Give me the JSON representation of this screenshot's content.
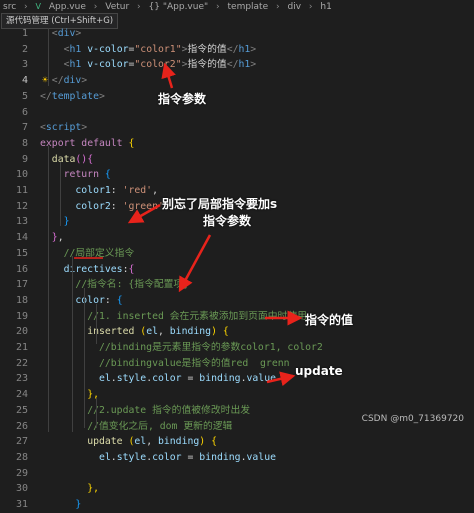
{
  "breadcrumb": {
    "items": [
      "src",
      "App.vue",
      "Vetur",
      "{} \"App.vue\"",
      "template",
      "div",
      "h1"
    ],
    "vue_badge": "V",
    "separator": "›"
  },
  "tooltip": {
    "text": "源代码管理 (Ctrl+Shift+G)"
  },
  "editor": {
    "active_line": 4,
    "lines": [
      {
        "n": "1",
        "tokens": [
          [
            "  ",
            "t-txt"
          ],
          [
            "<",
            "t-tag"
          ],
          [
            "div",
            "t-tagname"
          ],
          [
            ">",
            "t-tag"
          ]
        ]
      },
      {
        "n": "2",
        "tokens": [
          [
            "    ",
            "t-txt"
          ],
          [
            "<",
            "t-tag"
          ],
          [
            "h1",
            "t-tagname"
          ],
          [
            " ",
            "t-txt"
          ],
          [
            "v-color",
            "t-attr"
          ],
          [
            "=",
            "t-txt"
          ],
          [
            "\"color1\"",
            "t-str"
          ],
          [
            ">",
            "t-tag"
          ],
          [
            "指令的值",
            "t-txt"
          ],
          [
            "</",
            "t-tag"
          ],
          [
            "h1",
            "t-tagname"
          ],
          [
            ">",
            "t-tag"
          ]
        ]
      },
      {
        "n": "3",
        "tokens": [
          [
            "    ",
            "t-txt"
          ],
          [
            "<",
            "t-tag"
          ],
          [
            "h1",
            "t-tagname"
          ],
          [
            " ",
            "t-txt"
          ],
          [
            "v-color",
            "t-attr"
          ],
          [
            "=",
            "t-txt"
          ],
          [
            "\"color2\"",
            "t-str"
          ],
          [
            ">",
            "t-tag"
          ],
          [
            "指令的值",
            "t-txt"
          ],
          [
            "</",
            "t-tag"
          ],
          [
            "h1",
            "t-tagname"
          ],
          [
            ">",
            "t-tag"
          ]
        ]
      },
      {
        "n": "4",
        "tokens": [
          [
            "  ",
            "t-txt"
          ],
          [
            "</",
            "t-tag"
          ],
          [
            "div",
            "t-tagname"
          ],
          [
            ">",
            "t-tag"
          ]
        ]
      },
      {
        "n": "5",
        "tokens": [
          [
            "</",
            "t-tag"
          ],
          [
            "template",
            "t-tagname"
          ],
          [
            ">",
            "t-tag"
          ]
        ]
      },
      {
        "n": "6",
        "tokens": [
          [
            "",
            "t-txt"
          ]
        ]
      },
      {
        "n": "7",
        "tokens": [
          [
            "<",
            "t-tag"
          ],
          [
            "script",
            "t-tagname"
          ],
          [
            ">",
            "t-tag"
          ]
        ]
      },
      {
        "n": "8",
        "tokens": [
          [
            "export",
            "t-kw"
          ],
          [
            " ",
            "t-txt"
          ],
          [
            "default",
            "t-kw"
          ],
          [
            " ",
            "t-txt"
          ],
          [
            "{",
            "t-br"
          ]
        ]
      },
      {
        "n": "9",
        "tokens": [
          [
            "  ",
            "t-txt"
          ],
          [
            "data",
            "t-fn"
          ],
          [
            "(",
            "t-br2"
          ],
          [
            ")",
            "t-br2"
          ],
          [
            "{",
            "t-br2"
          ]
        ]
      },
      {
        "n": "10",
        "tokens": [
          [
            "    ",
            "t-txt"
          ],
          [
            "return",
            "t-kw"
          ],
          [
            " ",
            "t-txt"
          ],
          [
            "{",
            "t-br3"
          ]
        ]
      },
      {
        "n": "11",
        "tokens": [
          [
            "      ",
            "t-txt"
          ],
          [
            "color1",
            "t-var"
          ],
          [
            ": ",
            "t-txt"
          ],
          [
            "'red'",
            "t-str"
          ],
          [
            ",",
            "t-txt"
          ]
        ]
      },
      {
        "n": "12",
        "tokens": [
          [
            "      ",
            "t-txt"
          ],
          [
            "color2",
            "t-var"
          ],
          [
            ": ",
            "t-txt"
          ],
          [
            "'green'",
            "t-str"
          ]
        ]
      },
      {
        "n": "13",
        "tokens": [
          [
            "    ",
            "t-txt"
          ],
          [
            "}",
            "t-br3"
          ]
        ]
      },
      {
        "n": "14",
        "tokens": [
          [
            "  ",
            "t-txt"
          ],
          [
            "}",
            "t-br2"
          ],
          [
            ",",
            "t-txt"
          ]
        ]
      },
      {
        "n": "15",
        "tokens": [
          [
            "    ",
            "t-txt"
          ],
          [
            "//局部定义指令",
            "t-cm"
          ]
        ]
      },
      {
        "n": "16",
        "tokens": [
          [
            "    ",
            "t-txt"
          ],
          [
            "directives",
            "t-var"
          ],
          [
            ":",
            "t-txt"
          ],
          [
            "{",
            "t-br2"
          ]
        ]
      },
      {
        "n": "17",
        "tokens": [
          [
            "      ",
            "t-txt"
          ],
          [
            "//指令名: {指令配置项}",
            "t-cm"
          ]
        ]
      },
      {
        "n": "18",
        "tokens": [
          [
            "      ",
            "t-txt"
          ],
          [
            "color",
            "t-var"
          ],
          [
            ": ",
            "t-txt"
          ],
          [
            "{",
            "t-br3"
          ]
        ]
      },
      {
        "n": "19",
        "tokens": [
          [
            "        ",
            "t-txt"
          ],
          [
            "//1. inserted 会在元素被添加到页面中时使用",
            "t-cm"
          ]
        ]
      },
      {
        "n": "20",
        "tokens": [
          [
            "        ",
            "t-txt"
          ],
          [
            "inserted",
            "t-fn"
          ],
          [
            " ",
            "t-txt"
          ],
          [
            "(",
            "t-br"
          ],
          [
            "el",
            "t-var"
          ],
          [
            ", ",
            "t-txt"
          ],
          [
            "binding",
            "t-var"
          ],
          [
            ")",
            "t-br"
          ],
          [
            " ",
            "t-txt"
          ],
          [
            "{",
            "t-br"
          ]
        ]
      },
      {
        "n": "21",
        "tokens": [
          [
            "          ",
            "t-txt"
          ],
          [
            "//binding是元素里指令的参数color1, color2",
            "t-cm"
          ]
        ]
      },
      {
        "n": "22",
        "tokens": [
          [
            "          ",
            "t-txt"
          ],
          [
            "//bindingvalue是指令的值red  grenn",
            "t-cm"
          ]
        ]
      },
      {
        "n": "23",
        "tokens": [
          [
            "          ",
            "t-txt"
          ],
          [
            "el",
            "t-var"
          ],
          [
            ".",
            "t-txt"
          ],
          [
            "style",
            "t-var"
          ],
          [
            ".",
            "t-txt"
          ],
          [
            "color",
            "t-var"
          ],
          [
            " = ",
            "t-txt"
          ],
          [
            "binding",
            "t-var"
          ],
          [
            ".",
            "t-txt"
          ],
          [
            "value",
            "t-var"
          ]
        ]
      },
      {
        "n": "24",
        "tokens": [
          [
            "        ",
            "t-txt"
          ],
          [
            "},",
            "t-br"
          ]
        ]
      },
      {
        "n": "25",
        "tokens": [
          [
            "        ",
            "t-txt"
          ],
          [
            "//2.update 指令的值被修改时出发",
            "t-cm"
          ]
        ]
      },
      {
        "n": "26",
        "tokens": [
          [
            "        ",
            "t-txt"
          ],
          [
            "//值变化之后, dom 更新的逻辑",
            "t-cm"
          ]
        ]
      },
      {
        "n": "27",
        "tokens": [
          [
            "        ",
            "t-txt"
          ],
          [
            "update",
            "t-fn"
          ],
          [
            " ",
            "t-txt"
          ],
          [
            "(",
            "t-br"
          ],
          [
            "el",
            "t-var"
          ],
          [
            ", ",
            "t-txt"
          ],
          [
            "binding",
            "t-var"
          ],
          [
            ")",
            "t-br"
          ],
          [
            " ",
            "t-txt"
          ],
          [
            "{",
            "t-br"
          ]
        ]
      },
      {
        "n": "28",
        "tokens": [
          [
            "          ",
            "t-txt"
          ],
          [
            "el",
            "t-var"
          ],
          [
            ".",
            "t-txt"
          ],
          [
            "style",
            "t-var"
          ],
          [
            ".",
            "t-txt"
          ],
          [
            "color",
            "t-var"
          ],
          [
            " = ",
            "t-txt"
          ],
          [
            "binding",
            "t-var"
          ],
          [
            ".",
            "t-txt"
          ],
          [
            "value",
            "t-var"
          ]
        ]
      },
      {
        "n": "29",
        "tokens": [
          [
            "",
            "t-txt"
          ]
        ]
      },
      {
        "n": "30",
        "tokens": [
          [
            "        ",
            "t-txt"
          ],
          [
            "},",
            "t-br"
          ]
        ]
      },
      {
        "n": "31",
        "tokens": [
          [
            "      ",
            "t-txt"
          ],
          [
            "}",
            "t-br3"
          ]
        ]
      }
    ]
  },
  "annotations": {
    "param1": "指令参数",
    "dont_forget": "别忘了局部指令要加s",
    "param2": "指令参数",
    "value": "指令的值",
    "update": "update"
  },
  "colors": {
    "arrow": "#e8231b",
    "background": "#1e1e1e"
  },
  "watermark": "CSDN @m0_71369720"
}
